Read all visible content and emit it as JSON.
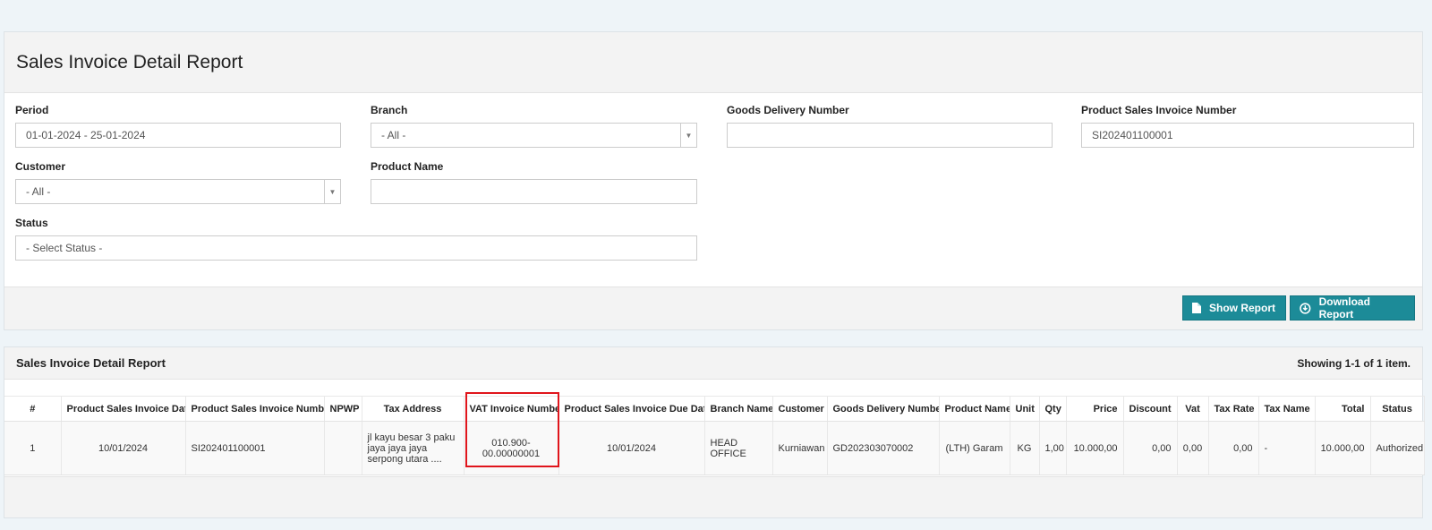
{
  "filter_panel": {
    "title": "Sales Invoice Detail Report",
    "fields": {
      "period": {
        "label": "Period",
        "value": "01-01-2024 - 25-01-2024"
      },
      "branch": {
        "label": "Branch",
        "value": "- All -"
      },
      "goods_delivery": {
        "label": "Goods Delivery Number",
        "value": ""
      },
      "invoice_number": {
        "label": "Product Sales Invoice Number",
        "value": "SI202401100001"
      },
      "customer": {
        "label": "Customer",
        "value": "- All -"
      },
      "product_name": {
        "label": "Product Name",
        "value": ""
      },
      "status": {
        "label": "Status",
        "placeholder": "- Select Status -"
      }
    },
    "buttons": {
      "show_report": "Show Report",
      "download_report": "Download Report"
    }
  },
  "report": {
    "title": "Sales Invoice Detail Report",
    "summary": "Showing 1-1 of 1 item.",
    "columns": [
      "#",
      "Product Sales Invoice Date",
      "Product Sales Invoice Number",
      "NPWP",
      "Tax Address",
      "VAT Invoice Number",
      "Product Sales Invoice Due Date",
      "Branch Name",
      "Customer",
      "Goods Delivery Number",
      "Product Name",
      "Unit",
      "Qty",
      "Price",
      "Discount",
      "Vat",
      "Tax Rate",
      "Tax Name",
      "Total",
      "Status"
    ],
    "rows": [
      [
        "1",
        "10/01/2024",
        "SI202401100001",
        "",
        "jl kayu besar 3 paku jaya jaya jaya serpong utara ....",
        "010.900-00.00000001",
        "10/01/2024",
        "HEAD OFFICE",
        "Kurniawan",
        "GD202303070002",
        "(LTH) Garam",
        "KG",
        "1,00",
        "10.000,00",
        "0,00",
        "0,00",
        "0,00",
        "-",
        "10.000,00",
        "Authorized"
      ]
    ]
  },
  "colors": {
    "accent": "#1c8b98",
    "highlight": "#e0151c"
  }
}
